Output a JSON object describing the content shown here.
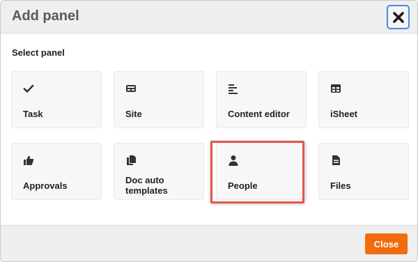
{
  "dialog": {
    "title": "Add panel",
    "close_icon": "close-x-icon",
    "section_label": "Select panel"
  },
  "panels": [
    {
      "label": "Task",
      "icon": "checkmark-icon"
    },
    {
      "label": "Site",
      "icon": "site-icon"
    },
    {
      "label": "Content editor",
      "icon": "text-align-icon"
    },
    {
      "label": "iSheet",
      "icon": "table-icon"
    },
    {
      "label": "Approvals",
      "icon": "thumbs-up-icon"
    },
    {
      "label": "Doc auto templates",
      "icon": "documents-icon"
    },
    {
      "label": "People",
      "icon": "person-icon"
    },
    {
      "label": "Files",
      "icon": "file-icon"
    }
  ],
  "footer": {
    "close_label": "Close"
  },
  "colors": {
    "accent": "#f16c0f",
    "highlight": "#e5554f",
    "focus": "#4a86e8",
    "icon": "#333333"
  }
}
